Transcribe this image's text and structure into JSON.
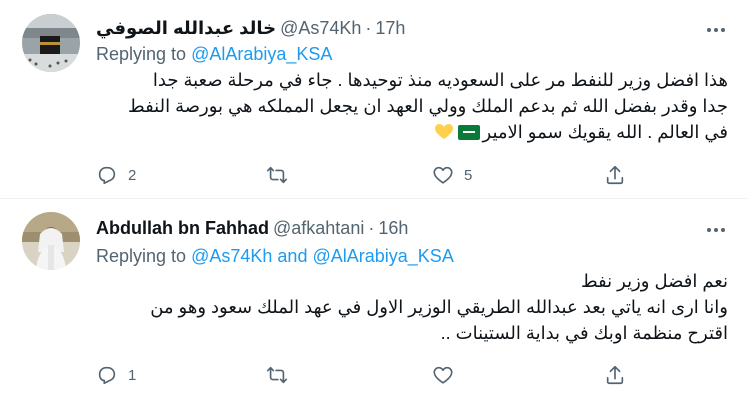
{
  "tweets": [
    {
      "author_name": "خالد عبدالله الصوفي",
      "handle": "@As74Kh",
      "separator": "·",
      "time": "17h",
      "replying_to_prefix": "Replying to",
      "replying_to": "@AlArabiya_KSA",
      "replying_to_second": "",
      "lines": [
        "هذا افضل وزير للنفط مر على السعوديه منذ توحيدها . جاء في مرحلة صعبة جدا",
        "جدا وقدر بفضل الله ثم بدعم الملك وولي العهد ان يجعل المملكه هي بورصة النفط",
        "في العالم . الله يقويك سمو الامير"
      ],
      "emoji_icons": [
        "saudi-flag-icon",
        "yellow-heart-icon"
      ],
      "colors": {
        "flag": "#0a7a3a",
        "heart": "#ffd04d"
      },
      "reply_count": "2",
      "retweet_count": "",
      "like_count": "5"
    },
    {
      "author_name": "Abdullah bn Fahhad",
      "handle": "@afkahtani",
      "separator": "·",
      "time": "16h",
      "replying_to_prefix": "Replying to",
      "replying_to": "@As74Kh",
      "replying_to_joiner": "and",
      "replying_to_second": "@AlArabiya_KSA",
      "lines": [
        "نعم افضل وزير نفط",
        "وانا ارى انه ياتي بعد عبدالله الطريقي الوزير الاول في عهد الملك سعود وهو من",
        "اقترح منظمة اوبك في بداية الستينات .."
      ],
      "reply_count": "1",
      "retweet_count": "",
      "like_count": ""
    }
  ],
  "colors": {
    "link": "#1d9bf0",
    "muted": "#536471",
    "text": "#0f1419",
    "divider": "#eff3f4"
  }
}
